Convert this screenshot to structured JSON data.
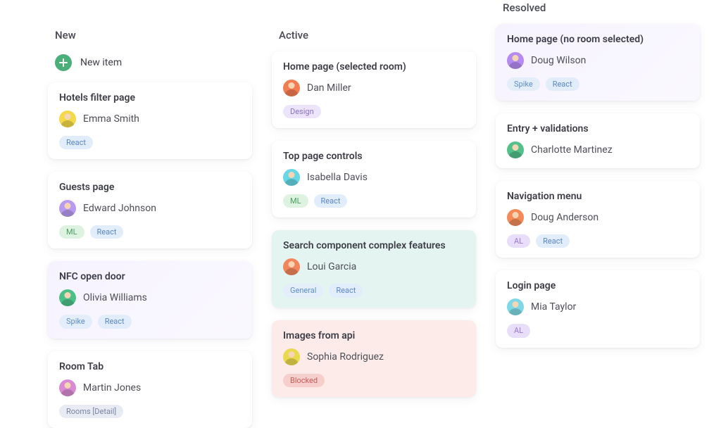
{
  "columns": {
    "new": {
      "title": "New",
      "new_item_label": "New item",
      "cards": [
        {
          "title": "Hotels filter page",
          "assignee": "Emma Smith",
          "avatar_bg": "#f3d94a",
          "pills": [
            {
              "kind": "react",
              "label": "React"
            }
          ]
        },
        {
          "title": "Guests page",
          "assignee": "Edward Johnson",
          "avatar_bg": "#b79bf0",
          "pills": [
            {
              "kind": "ml",
              "label": "ML"
            },
            {
              "kind": "react",
              "label": "React"
            }
          ]
        },
        {
          "title": "NFC open door",
          "assignee": "Olivia Williams",
          "avatar_bg": "#4dc089",
          "bg": "lilac",
          "pills": [
            {
              "kind": "spike",
              "label": "Spike"
            },
            {
              "kind": "react",
              "label": "React"
            }
          ]
        },
        {
          "title": "Room Tab",
          "assignee": "Martin Jones",
          "avatar_bg": "#d98ad4",
          "pills": [
            {
              "kind": "rooms",
              "label": "Rooms [Detail]"
            }
          ]
        }
      ]
    },
    "active": {
      "title": "Active",
      "cards": [
        {
          "title": "Home page (selected room)",
          "assignee": "Dan Miller",
          "avatar_bg": "#f27d52",
          "pills": [
            {
              "kind": "design",
              "label": "Design"
            }
          ]
        },
        {
          "title": "Top page controls",
          "assignee": "Isabella Davis",
          "avatar_bg": "#67d6e5",
          "pills": [
            {
              "kind": "ml",
              "label": "ML"
            },
            {
              "kind": "react",
              "label": "React"
            }
          ]
        },
        {
          "title": "Search component complex features",
          "assignee": "Loui Garcia",
          "avatar_bg": "#f2855c",
          "bg": "teal",
          "pills": [
            {
              "kind": "general",
              "label": "General"
            },
            {
              "kind": "react",
              "label": "React"
            }
          ]
        },
        {
          "title": "Images from api",
          "assignee": "Sophia Rodriguez",
          "avatar_bg": "#e9d94c",
          "bg": "rose",
          "pills": [
            {
              "kind": "blocked",
              "label": "Blocked"
            }
          ]
        }
      ]
    },
    "resolved": {
      "title": "Resolved",
      "cards": [
        {
          "title": "Home page (no room selected)",
          "assignee": "Doug Wilson",
          "avatar_bg": "#b58bf2",
          "bg": "lilac",
          "pills": [
            {
              "kind": "spike",
              "label": "Spike"
            },
            {
              "kind": "react",
              "label": "React"
            }
          ]
        },
        {
          "title": "Entry + validations",
          "assignee": "Charlotte Martinez",
          "avatar_bg": "#54c08a",
          "pills": []
        },
        {
          "title": "Navigation menu",
          "assignee": "Doug Anderson",
          "avatar_bg": "#f38a58",
          "pills": [
            {
              "kind": "al",
              "label": "AL"
            },
            {
              "kind": "react",
              "label": "React"
            }
          ]
        },
        {
          "title": "Login page",
          "assignee": "Mia Taylor",
          "avatar_bg": "#7fd8e5",
          "pills": [
            {
              "kind": "al",
              "label": "AL"
            }
          ]
        }
      ]
    }
  }
}
